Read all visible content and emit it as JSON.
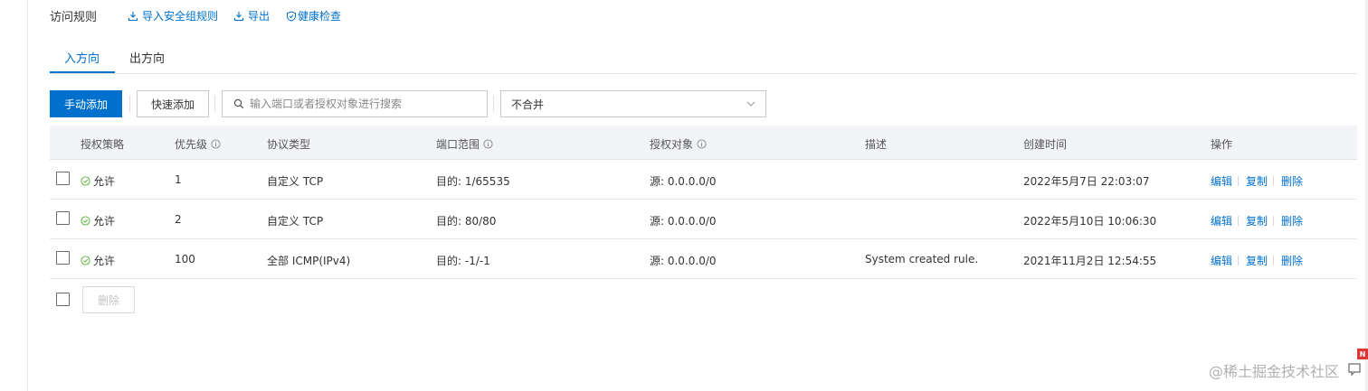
{
  "header": {
    "title": "访问规则",
    "actions": [
      {
        "label": "导入安全组规则",
        "icon": "import-icon"
      },
      {
        "label": "导出",
        "icon": "export-icon"
      },
      {
        "label": "健康检查",
        "icon": "shield-check-icon"
      }
    ]
  },
  "tabs": [
    {
      "label": "入方向",
      "active": true
    },
    {
      "label": "出方向",
      "active": false
    }
  ],
  "toolbar": {
    "manual_add": "手动添加",
    "quick_add": "快速添加",
    "search_placeholder": "输入端口或者授权对象进行搜索",
    "merge_select": "不合并"
  },
  "table": {
    "headers": {
      "policy": "授权策略",
      "priority": "优先级",
      "protocol": "协议类型",
      "port_range": "端口范围",
      "auth_object": "授权对象",
      "description": "描述",
      "created": "创建时间",
      "actions": "操作"
    },
    "rows": [
      {
        "policy": "允许",
        "priority": "1",
        "protocol": "自定义 TCP",
        "port": "目的: 1/65535",
        "source": "源: 0.0.0.0/0",
        "description": "",
        "created": "2022年5月7日 22:03:07"
      },
      {
        "policy": "允许",
        "priority": "2",
        "protocol": "自定义 TCP",
        "port": "目的: 80/80",
        "source": "源: 0.0.0.0/0",
        "description": "",
        "created": "2022年5月10日 10:06:30"
      },
      {
        "policy": "允许",
        "priority": "100",
        "protocol": "全部 ICMP(IPv4)",
        "port": "目的: -1/-1",
        "source": "源: 0.0.0.0/0",
        "description": "System created rule.",
        "created": "2021年11月2日 12:54:55"
      }
    ],
    "row_actions": {
      "edit": "编辑",
      "copy": "复制",
      "delete": "删除"
    }
  },
  "footer": {
    "delete_button": "删除"
  },
  "watermark": "@稀土掘金技术社区",
  "badge": "N",
  "colors": {
    "accent": "#0070cc",
    "success": "#52b030",
    "header_bg": "#f2f4f7",
    "badge": "#e03535"
  }
}
